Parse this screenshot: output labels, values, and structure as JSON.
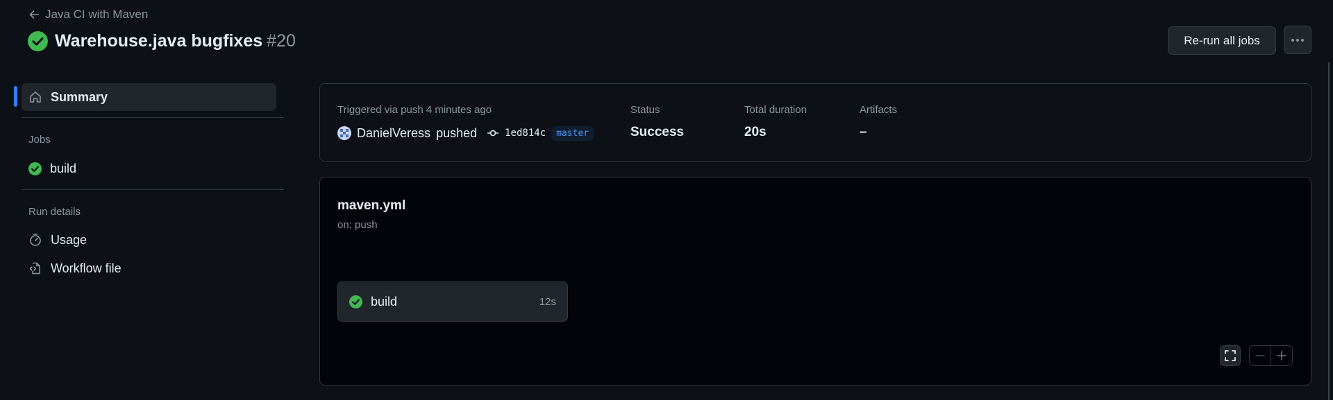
{
  "header": {
    "back_label": "Java CI with Maven",
    "title": "Warehouse.java bugfixes",
    "run_number": "#20",
    "rerun_label": "Re-run all jobs"
  },
  "sidebar": {
    "summary_label": "Summary",
    "jobs_heading": "Jobs",
    "jobs": [
      {
        "label": "build",
        "status": "success"
      }
    ],
    "run_details_heading": "Run details",
    "details": [
      {
        "label": "Usage",
        "icon": "stopwatch-icon"
      },
      {
        "label": "Workflow file",
        "icon": "file-code-icon"
      }
    ]
  },
  "summary": {
    "triggered_label": "Triggered via push 4 minutes ago",
    "actor": "DanielVeress",
    "action": "pushed",
    "commit_sha": "1ed814c",
    "branch": "master",
    "status_label": "Status",
    "status_value": "Success",
    "duration_label": "Total duration",
    "duration_value": "20s",
    "artifacts_label": "Artifacts",
    "artifacts_value": "–"
  },
  "workflow": {
    "file_name": "maven.yml",
    "trigger": "on: push",
    "jobs": [
      {
        "name": "build",
        "duration": "12s",
        "status": "success"
      }
    ]
  },
  "colors": {
    "background": "#0d1117",
    "success": "#3fb950",
    "accent": "#2f81f7",
    "muted_text": "#8d96a0"
  }
}
